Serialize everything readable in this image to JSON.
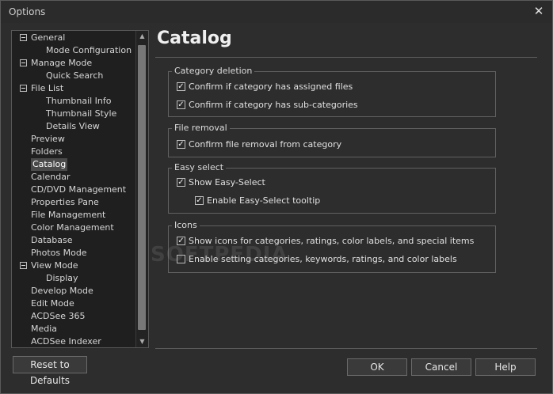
{
  "window": {
    "title": "Options",
    "close_glyph": "✕"
  },
  "tree": {
    "items": [
      {
        "label": "General",
        "level": 0,
        "expander": true
      },
      {
        "label": "Mode Configuration",
        "level": 1
      },
      {
        "label": "Manage Mode",
        "level": 0,
        "expander": true
      },
      {
        "label": "Quick Search",
        "level": 1
      },
      {
        "label": "File List",
        "level": 0,
        "expander": true
      },
      {
        "label": "Thumbnail Info",
        "level": 1
      },
      {
        "label": "Thumbnail Style",
        "level": 1
      },
      {
        "label": "Details View",
        "level": 1
      },
      {
        "label": "Preview",
        "level": 0
      },
      {
        "label": "Folders",
        "level": 0
      },
      {
        "label": "Catalog",
        "level": 0,
        "selected": true
      },
      {
        "label": "Calendar",
        "level": 0
      },
      {
        "label": "CD/DVD Management",
        "level": 0
      },
      {
        "label": "Properties Pane",
        "level": 0
      },
      {
        "label": "File Management",
        "level": 0
      },
      {
        "label": "Color Management",
        "level": 0
      },
      {
        "label": "Database",
        "level": 0
      },
      {
        "label": "Photos Mode",
        "level": 0
      },
      {
        "label": "View Mode",
        "level": 0,
        "expander": true
      },
      {
        "label": "Display",
        "level": 1
      },
      {
        "label": "Develop Mode",
        "level": 0
      },
      {
        "label": "Edit Mode",
        "level": 0
      },
      {
        "label": "ACDSee 365",
        "level": 0
      },
      {
        "label": "Media",
        "level": 0
      },
      {
        "label": "ACDSee Indexer",
        "level": 0
      }
    ],
    "scroll_up_glyph": "▲",
    "scroll_down_glyph": "▼"
  },
  "page": {
    "heading": "Catalog"
  },
  "groups": {
    "category_deletion": {
      "title": "Category deletion",
      "options": [
        {
          "label": "Confirm if category has assigned files",
          "checked": true
        },
        {
          "label": "Confirm if category has sub-categories",
          "checked": true
        }
      ]
    },
    "file_removal": {
      "title": "File removal",
      "options": [
        {
          "label": "Confirm file removal from category",
          "checked": true
        }
      ]
    },
    "easy_select": {
      "title": "Easy select",
      "options": [
        {
          "label": "Show Easy-Select",
          "checked": true
        },
        {
          "label": "Enable Easy-Select tooltip",
          "checked": true
        }
      ]
    },
    "icons": {
      "title": "Icons",
      "options": [
        {
          "label": "Show icons for categories, ratings, color labels, and special items",
          "checked": true
        },
        {
          "label": "Enable setting categories, keywords, ratings, and color labels",
          "checked": false
        }
      ]
    }
  },
  "watermark": "SOFTPEDIA",
  "buttons": {
    "reset": "Reset to Defaults",
    "ok": "OK",
    "cancel": "Cancel",
    "help": "Help"
  },
  "check_glyph": "✓"
}
